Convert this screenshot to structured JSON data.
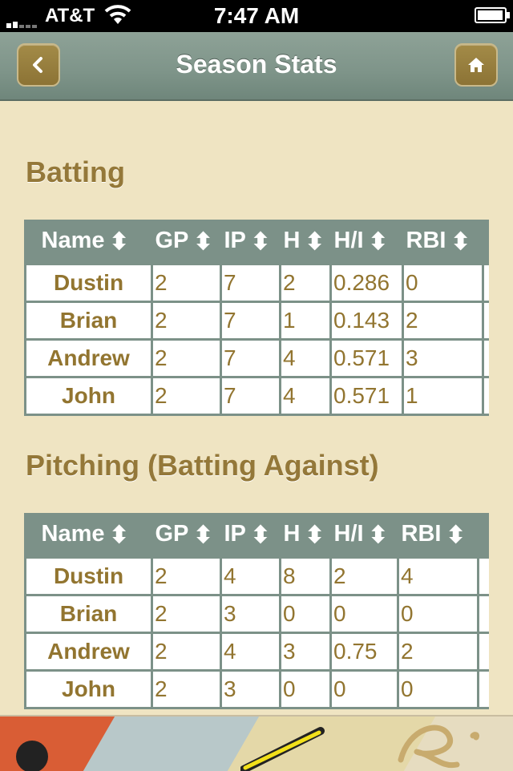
{
  "status": {
    "carrier": "AT&T",
    "time": "7:47 AM"
  },
  "nav": {
    "title": "Season Stats",
    "back_icon": "chevron-left-icon",
    "home_icon": "home-icon"
  },
  "batting": {
    "title": "Batting",
    "columns": [
      "Name",
      "GP",
      "IP",
      "H",
      "H/I",
      "RBI"
    ],
    "rows": [
      {
        "name": "Dustin",
        "gp": "2",
        "ip": "7",
        "h": "2",
        "hi": "0.286",
        "rbi": "0"
      },
      {
        "name": "Brian",
        "gp": "2",
        "ip": "7",
        "h": "1",
        "hi": "0.143",
        "rbi": "2"
      },
      {
        "name": "Andrew",
        "gp": "2",
        "ip": "7",
        "h": "4",
        "hi": "0.571",
        "rbi": "3"
      },
      {
        "name": "John",
        "gp": "2",
        "ip": "7",
        "h": "4",
        "hi": "0.571",
        "rbi": "1"
      }
    ]
  },
  "pitching": {
    "title": "Pitching (Batting Against)",
    "columns": [
      "Name",
      "GP",
      "IP",
      "H",
      "H/I",
      "RBI"
    ],
    "rows": [
      {
        "name": "Dustin",
        "gp": "2",
        "ip": "4",
        "h": "8",
        "hi": "2",
        "rbi": "4"
      },
      {
        "name": "Brian",
        "gp": "2",
        "ip": "3",
        "h": "0",
        "hi": "0",
        "rbi": "0"
      },
      {
        "name": "Andrew",
        "gp": "2",
        "ip": "4",
        "h": "3",
        "hi": "0.75",
        "rbi": "2"
      },
      {
        "name": "John",
        "gp": "2",
        "ip": "3",
        "h": "0",
        "hi": "0",
        "rbi": "0"
      }
    ]
  },
  "colors": {
    "accent": "#947839",
    "header": "#7c9188",
    "background": "#efe4c2"
  }
}
